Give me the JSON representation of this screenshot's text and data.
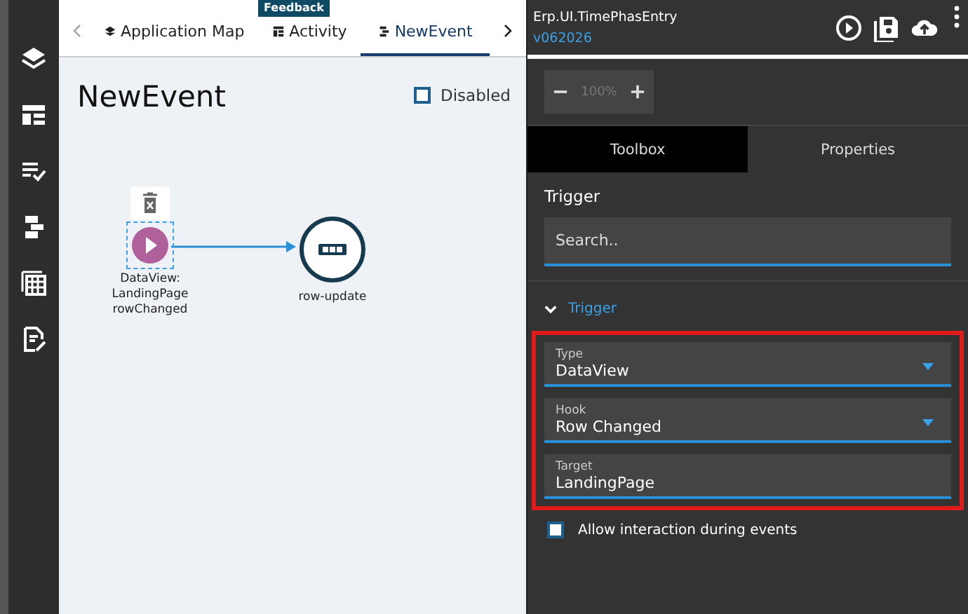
{
  "feedback": "Feedback",
  "tabs": [
    {
      "label": "Application Map",
      "selected": false
    },
    {
      "label": "Activity",
      "selected": false
    },
    {
      "label": "NewEvent",
      "selected": true
    }
  ],
  "page": {
    "title": "NewEvent",
    "disabled": {
      "label": "Disabled",
      "checked": false
    }
  },
  "canvas": {
    "nodes": [
      {
        "kind": "trigger",
        "lines": [
          "DataView:",
          "LandingPage",
          "rowChanged"
        ],
        "selected": true
      },
      {
        "kind": "action",
        "lines": [
          "row-update"
        ],
        "selected": false
      }
    ]
  },
  "panel": {
    "app_name": "Erp.UI.TimePhasEntry",
    "version": "v062026",
    "zoom": "100%",
    "tabs": [
      {
        "label": "Toolbox",
        "selected": true
      },
      {
        "label": "Properties",
        "selected": false
      }
    ],
    "heading": "Trigger",
    "search": {
      "placeholder": "Search.."
    },
    "section": {
      "label": "Trigger",
      "expanded": true
    },
    "fields": [
      {
        "kind": "select",
        "label": "Type",
        "value": "DataView"
      },
      {
        "kind": "select",
        "label": "Hook",
        "value": "Row Changed"
      },
      {
        "kind": "text",
        "label": "Target",
        "value": "LandingPage"
      }
    ],
    "option": {
      "label": "Allow interaction during events",
      "checked": false
    }
  }
}
